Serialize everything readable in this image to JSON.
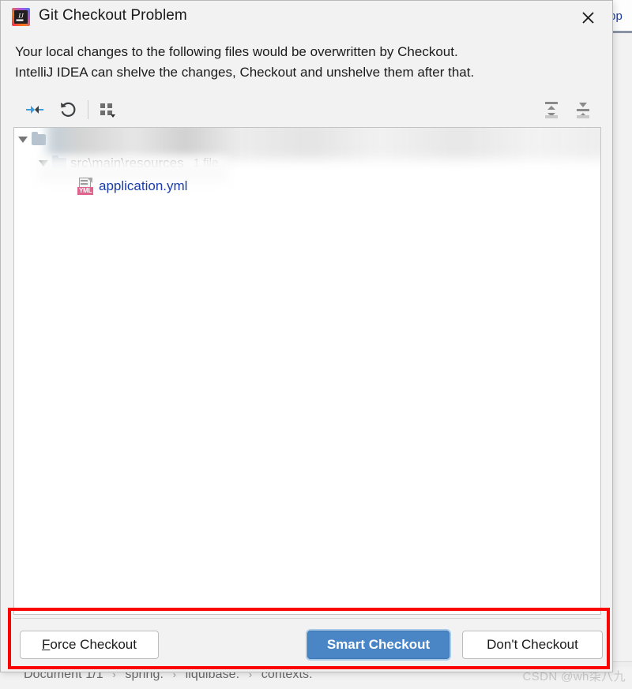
{
  "dialog": {
    "title": "Git Checkout Problem",
    "logo_icon": "intellij-idea-logo",
    "close_icon": "close-icon",
    "message_lines": [
      "Your local changes to the following files would be overwritten by Checkout.",
      "IntelliJ IDEA can shelve the changes, Checkout and unshelve them after that."
    ]
  },
  "toolbar": {
    "buttons": [
      {
        "name": "show-diff-icon",
        "tooltip": "Show Diff",
        "color": "#3b9bdc"
      },
      {
        "name": "revert-icon",
        "tooltip": "Revert",
        "color": "#3c3f41"
      },
      {
        "name": "group-by-icon",
        "tooltip": "Group By",
        "color": "#6e6e6e"
      },
      {
        "name": "expand-all-icon",
        "tooltip": "Expand All",
        "color": "#8a8a8a"
      },
      {
        "name": "collapse-all-icon",
        "tooltip": "Collapse All",
        "color": "#8a8a8a"
      }
    ]
  },
  "tree": {
    "rows": [
      {
        "type": "root",
        "label": "",
        "redacted": true,
        "expanded": true
      },
      {
        "type": "folder",
        "label": "src\\main\\resources",
        "count": "1 file",
        "expanded": true
      },
      {
        "type": "file",
        "label": "application.yml",
        "icon": "yml-file-icon",
        "tag": "YML",
        "color": "#1a3ca8"
      }
    ]
  },
  "buttons": {
    "force_checkout": {
      "label": "Force Checkout",
      "mnemonic": "F",
      "rest": "orce Checkout"
    },
    "smart_checkout": {
      "label": "Smart Checkout"
    },
    "dont_checkout": {
      "label": "Don't Checkout"
    }
  },
  "background": {
    "editor_tab_text": "pp",
    "breadcrumb": {
      "document": "Document 1/1",
      "sep": "›",
      "parts": [
        "spring.",
        "liquibase.",
        "contexts."
      ]
    },
    "watermark": "CSDN @wh柒八九"
  },
  "annotation": {
    "color": "#fb0404"
  }
}
